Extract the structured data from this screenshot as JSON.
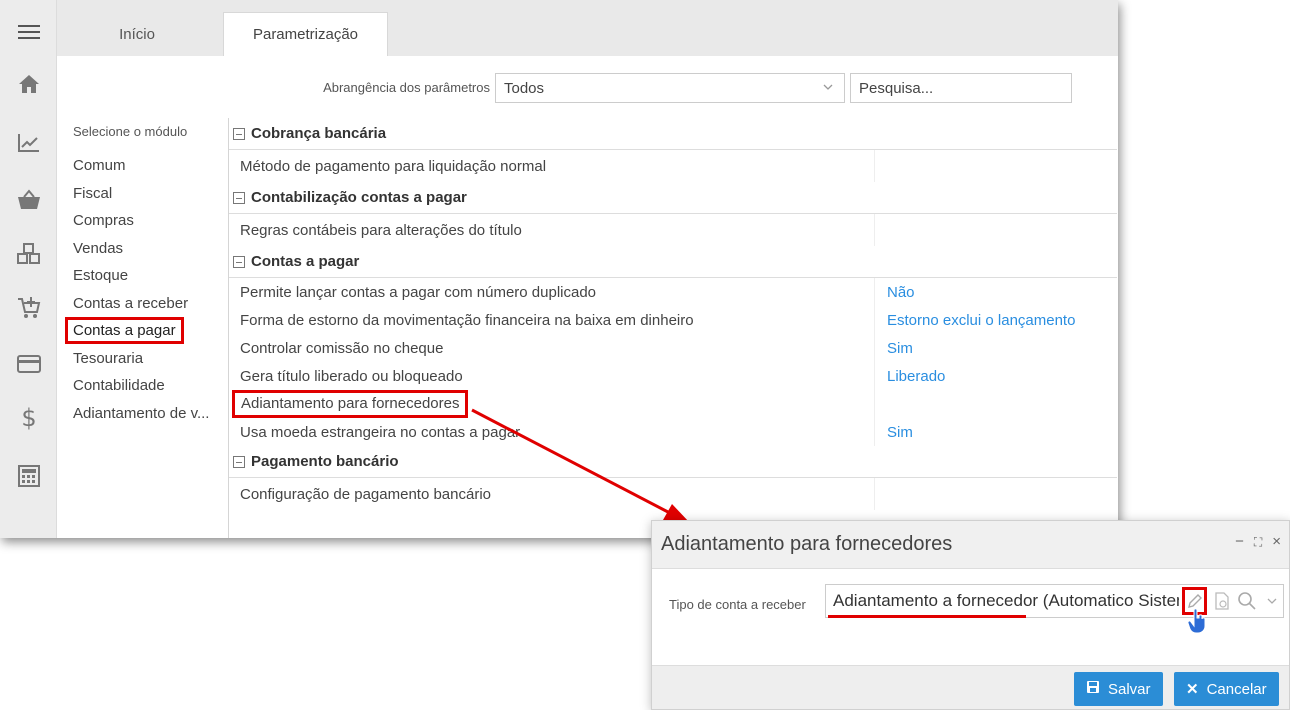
{
  "tabs": [
    {
      "label": "Início"
    },
    {
      "label": "Parametrização"
    }
  ],
  "sidebar_icons": [
    "menu-icon",
    "home-icon",
    "chart-trend-icon",
    "basket-icon",
    "boxes-icon",
    "cart-icon",
    "card-icon",
    "dollar-icon",
    "calculator-icon"
  ],
  "filters": {
    "scope_label": "Abrangência dos parâmetros",
    "scope_value": "Todos",
    "search_placeholder": "Pesquisa..."
  },
  "modules": {
    "header": "Selecione o módulo",
    "items": [
      "Comum",
      "Fiscal",
      "Compras",
      "Vendas",
      "Estoque",
      "Contas a receber",
      "Contas a pagar",
      "Tesouraria",
      "Contabilidade",
      "Adiantamento de v..."
    ],
    "selected": "Contas a pagar"
  },
  "groups": [
    {
      "title": "Cobrança bancária",
      "params": [
        {
          "name": "Método de pagamento para liquidação normal",
          "value": ""
        }
      ]
    },
    {
      "title": "Contabilização contas a pagar",
      "params": [
        {
          "name": "Regras contábeis para alterações do título",
          "value": ""
        }
      ]
    },
    {
      "title": "Contas a pagar",
      "params": [
        {
          "name": "Permite lançar contas a pagar com número duplicado",
          "value": "Não"
        },
        {
          "name": "Forma de estorno da movimentação financeira na baixa em dinheiro",
          "value": "Estorno exclui o lançamento"
        },
        {
          "name": "Controlar comissão no cheque",
          "value": "Sim"
        },
        {
          "name": "Gera título liberado ou bloqueado",
          "value": "Liberado"
        },
        {
          "name": "Adiantamento para fornecedores",
          "value": ""
        },
        {
          "name": "Usa moeda estrangeira no contas a pagar",
          "value": "Sim"
        }
      ]
    },
    {
      "title": "Pagamento bancário",
      "params": [
        {
          "name": "Configuração de pagamento bancário",
          "value": ""
        }
      ]
    }
  ],
  "dialog": {
    "title": "Adiantamento para fornecedores",
    "controls": [
      "−",
      "⛶",
      "×"
    ],
    "field_label": "Tipo de conta a receber",
    "field_value": "Adiantamento a fornecedor (Automatico Sistema)",
    "save_label": "Salvar",
    "cancel_label": "Cancelar"
  },
  "colors": {
    "accent": "#2b8dd6",
    "value_link": "#2a8ee0",
    "annotation_red": "#e00000"
  }
}
